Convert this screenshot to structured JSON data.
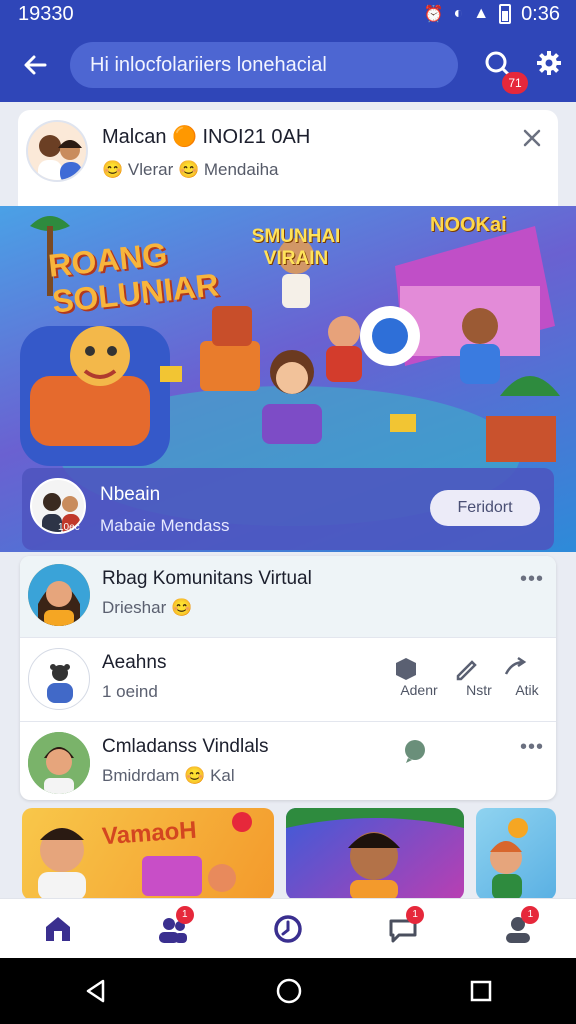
{
  "status_bar": {
    "time": "19330",
    "clock": "0:36"
  },
  "app_bar": {
    "search_text": "Hi inlocfolariiers lonehacial",
    "notif_count": "71"
  },
  "header_card": {
    "name": "Malcan 🟠 INOI21 0AH",
    "subtitle": "😊 Vlerar 😊 Mendaiha"
  },
  "hero": {
    "title_left": "ROANG SOLUNIAR",
    "title_center": "SMUNHAI VIRAIN",
    "title_right": "NOOKai",
    "panel": {
      "name": "Nbeain",
      "subtitle": "Mabaie Mendass",
      "avatar_tag": "10ec",
      "follow_label": "Feridort"
    }
  },
  "list": [
    {
      "title": "Rbag Komunitans Virtual",
      "subtitle": "Drieshar 😊"
    },
    {
      "title": "Aeahns",
      "subtitle": "1 oeind",
      "actions": [
        "Adenr",
        "Nstr",
        "Atik"
      ]
    },
    {
      "title": "Cmladanss Vindlals",
      "subtitle": "Bmidrdam 😊 Kal"
    }
  ],
  "thumbnails": {
    "first_text": "VamaoH"
  },
  "bottom_nav": {
    "badge_friends": "1",
    "badge_messages": "1",
    "badge_profile": "1"
  },
  "colors": {
    "primary": "#2f46b8",
    "badge": "#e6283b",
    "accent_orange": "#f5a623"
  },
  "icons": [
    "back-arrow-icon",
    "search-icon",
    "gear-icon",
    "close-icon",
    "home-icon",
    "friends-icon",
    "clock-icon",
    "chat-icon",
    "profile-icon",
    "back-triangle-icon",
    "home-circle-icon",
    "recents-square-icon"
  ]
}
